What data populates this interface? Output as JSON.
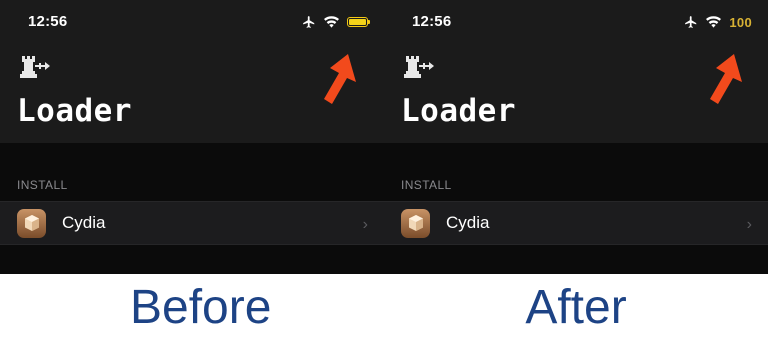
{
  "before": {
    "status": {
      "time": "12:56"
    },
    "title": "Loader",
    "section": "INSTALL",
    "row": {
      "label": "Cydia",
      "chevron": "›"
    },
    "caption": "Before"
  },
  "after": {
    "status": {
      "time": "12:56",
      "battery_text": "100"
    },
    "title": "Loader",
    "section": "INSTALL",
    "row": {
      "label": "Cydia",
      "chevron": "›"
    },
    "caption": "After"
  },
  "icons": [
    "airplane-icon",
    "wifi-icon",
    "battery-icon",
    "rook-logo-icon",
    "cydia-app-icon",
    "chevron-right-icon",
    "red-arrow-icon"
  ],
  "colors": {
    "header_bg": "#1b1b1b",
    "body_bg": "#0b0b0b",
    "row_bg": "#1c1c1e",
    "battery_yellow": "#f4d319",
    "battery_text": "#d8b234",
    "arrow_red": "#f24a1c",
    "caption_blue": "#1d4385"
  }
}
